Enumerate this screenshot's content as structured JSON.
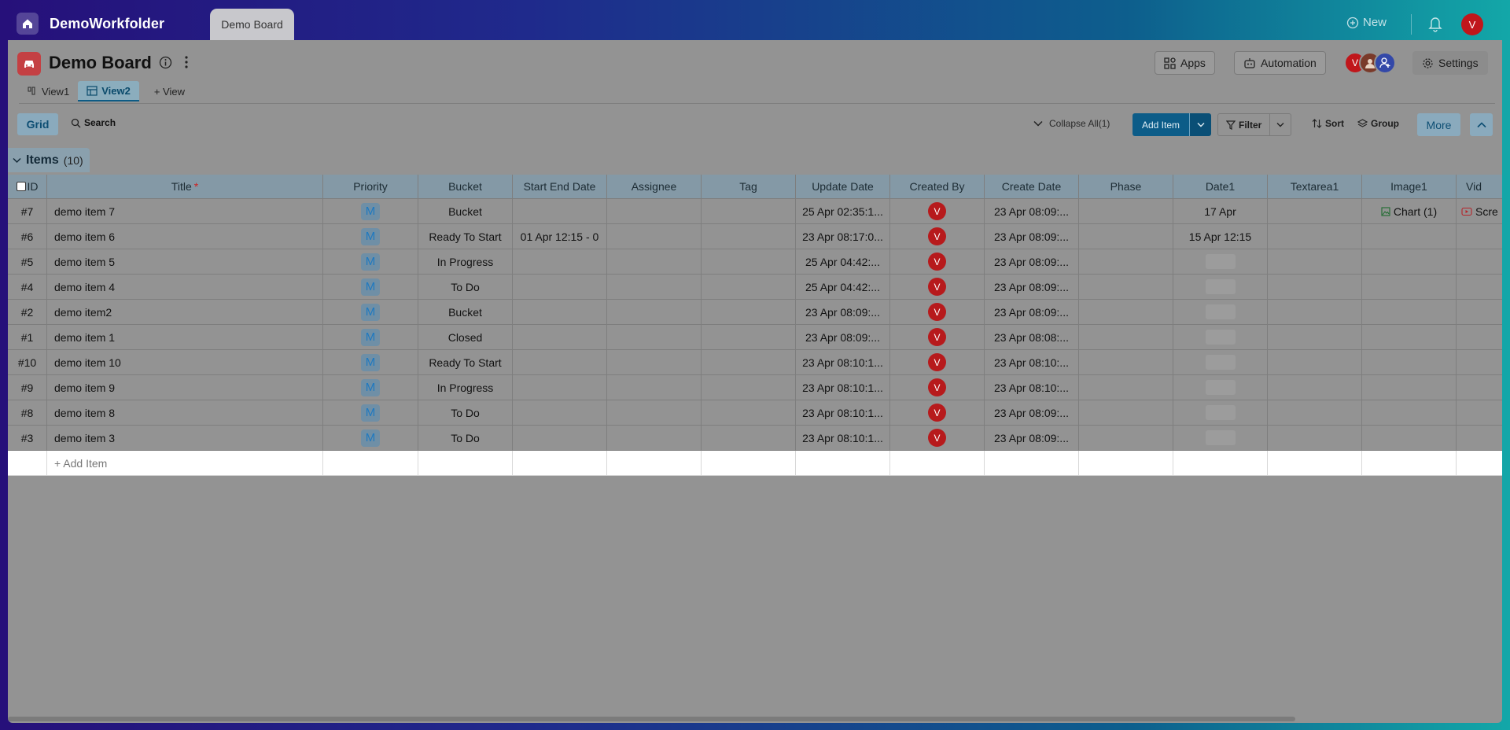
{
  "topbar": {
    "workspace_name": "DemoWorkfolder",
    "active_tab": "Demo Board",
    "new_label": "New",
    "user_initial": "V"
  },
  "board": {
    "title": "Demo Board",
    "apps_label": "Apps",
    "automation_label": "Automation",
    "settings_label": "Settings",
    "member_initials": [
      "V"
    ]
  },
  "views": {
    "tabs": [
      {
        "label": "View1",
        "active": false
      },
      {
        "label": "View2",
        "active": true
      }
    ],
    "add_view_label": "+ View"
  },
  "toolbar": {
    "grid_label": "Grid",
    "search_label": "Search",
    "collapse_all_label": "Collapse All(1)",
    "add_item_label": "Add Item",
    "filter_label": "Filter",
    "sort_label": "Sort",
    "group_label": "Group",
    "more_label": "More"
  },
  "group": {
    "title": "Items",
    "count": "(10)"
  },
  "columns": [
    "ID",
    "Title",
    "Priority",
    "Bucket",
    "Start End Date",
    "Assignee",
    "Tag",
    "Update Date",
    "Created By",
    "Create Date",
    "Phase",
    "Date1",
    "Textarea1",
    "Image1",
    "Vid"
  ],
  "rows": [
    {
      "id": "#7",
      "title": "demo item 7",
      "priority": "M",
      "bucket": "Bucket",
      "start_end": "",
      "update": "25 Apr 02:35:1...",
      "created_by": "V",
      "create": "23 Apr 08:09:...",
      "date1": "17 Apr",
      "image1": "Chart (1)",
      "vid": "Scre"
    },
    {
      "id": "#6",
      "title": "demo item 6",
      "priority": "M",
      "bucket": "Ready To Start",
      "start_end": "01 Apr 12:15  -  0",
      "update": "23 Apr 08:17:0...",
      "created_by": "V",
      "create": "23 Apr 08:09:...",
      "date1": "15 Apr 12:15",
      "image1": "",
      "vid": ""
    },
    {
      "id": "#5",
      "title": "demo item 5",
      "priority": "M",
      "bucket": "In Progress",
      "start_end": "",
      "update": "25 Apr 04:42:...",
      "created_by": "V",
      "create": "23 Apr 08:09:...",
      "date1": "",
      "image1": "",
      "vid": ""
    },
    {
      "id": "#4",
      "title": "demo item 4",
      "priority": "M",
      "bucket": "To Do",
      "start_end": "",
      "update": "25 Apr 04:42:...",
      "created_by": "V",
      "create": "23 Apr 08:09:...",
      "date1": "",
      "image1": "",
      "vid": ""
    },
    {
      "id": "#2",
      "title": "demo item2",
      "priority": "M",
      "bucket": "Bucket",
      "start_end": "",
      "update": "23 Apr 08:09:...",
      "created_by": "V",
      "create": "23 Apr 08:09:...",
      "date1": "",
      "image1": "",
      "vid": ""
    },
    {
      "id": "#1",
      "title": "demo item 1",
      "priority": "M",
      "bucket": "Closed",
      "start_end": "",
      "update": "23 Apr 08:09:...",
      "created_by": "V",
      "create": "23 Apr 08:08:...",
      "date1": "",
      "image1": "",
      "vid": ""
    },
    {
      "id": "#10",
      "title": "demo item 10",
      "priority": "M",
      "bucket": "Ready To Start",
      "start_end": "",
      "update": "23 Apr 08:10:1...",
      "created_by": "V",
      "create": "23 Apr 08:10:...",
      "date1": "",
      "image1": "",
      "vid": ""
    },
    {
      "id": "#9",
      "title": "demo item 9",
      "priority": "M",
      "bucket": "In Progress",
      "start_end": "",
      "update": "23 Apr 08:10:1...",
      "created_by": "V",
      "create": "23 Apr 08:10:...",
      "date1": "",
      "image1": "",
      "vid": ""
    },
    {
      "id": "#8",
      "title": "demo item 8",
      "priority": "M",
      "bucket": "To Do",
      "start_end": "",
      "update": "23 Apr 08:10:1...",
      "created_by": "V",
      "create": "23 Apr 08:09:...",
      "date1": "",
      "image1": "",
      "vid": ""
    },
    {
      "id": "#3",
      "title": "demo item 3",
      "priority": "M",
      "bucket": "To Do",
      "start_end": "",
      "update": "23 Apr 08:10:1...",
      "created_by": "V",
      "create": "23 Apr 08:09:...",
      "date1": "",
      "image1": "",
      "vid": ""
    }
  ],
  "add_row_label": "+ Add Item",
  "colors": {
    "accent": "#0c5c88",
    "avatar_red": "#c0161b",
    "overlay_gray": "#939393"
  },
  "icons": [
    "home-icon",
    "plus-circle-icon",
    "bell-icon",
    "info-icon",
    "kebab-icon",
    "apps-icon",
    "robot-icon",
    "gear-icon",
    "search-icon",
    "chevron-down-icon",
    "filter-icon",
    "sort-icon",
    "layers-icon",
    "chevron-up-icon",
    "grid-icon",
    "image-icon",
    "video-icon"
  ]
}
